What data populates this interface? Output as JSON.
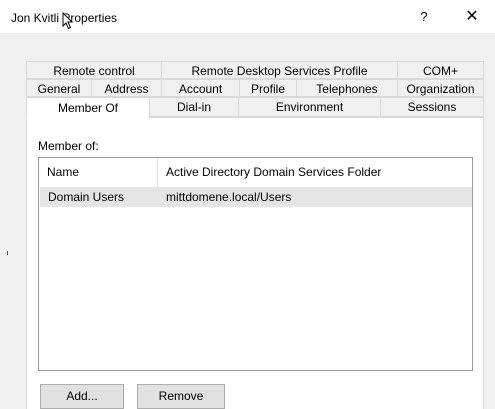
{
  "window": {
    "title": "Jon Kvitli Properties",
    "help_label": "?",
    "close_label": "✕"
  },
  "tabs": {
    "row1": [
      "Remote control",
      "Remote Desktop Services Profile",
      "COM+"
    ],
    "row2": [
      "General",
      "Address",
      "Account",
      "Profile",
      "Telephones",
      "Organization"
    ],
    "row3": [
      "Member Of",
      "Dial-in",
      "Environment",
      "Sessions"
    ],
    "active": "Member Of"
  },
  "panel": {
    "member_of_label": "Member of:",
    "columns": [
      "Name",
      "Active Directory Domain Services Folder"
    ],
    "rows": [
      {
        "name": "Domain Users",
        "folder": "mittdomene.local/Users"
      }
    ]
  },
  "buttons": {
    "add": "Add...",
    "remove": "Remove"
  }
}
